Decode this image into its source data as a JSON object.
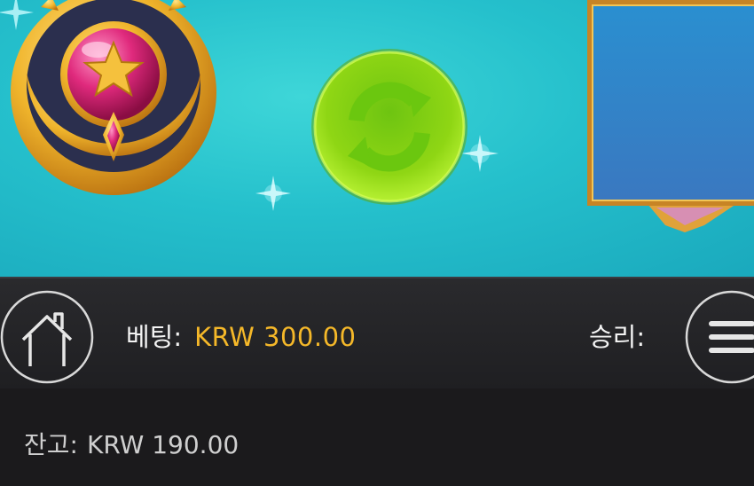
{
  "icons": {
    "emblem": "crescent-star-emblem-icon",
    "spin": "refresh-arrows-icon",
    "home": "house-icon",
    "menu": "hamburger-menu-icon",
    "sparkle": "sparkle-icon"
  },
  "colors": {
    "sky_top": "#3ed6d8",
    "sky_bottom": "#1aa9bd",
    "spin_green": "#8fd614",
    "gold": "#f0b52c",
    "jewel_pink": "#e02a7d",
    "bet_value": "#f5b829",
    "toolbar": "#232326"
  },
  "toolbar": {
    "bet_label": "베팅:",
    "bet_value": "KRW 300.00",
    "win_label": "승리:"
  },
  "balance": {
    "label": "잔고:",
    "value": "KRW 190.00"
  }
}
